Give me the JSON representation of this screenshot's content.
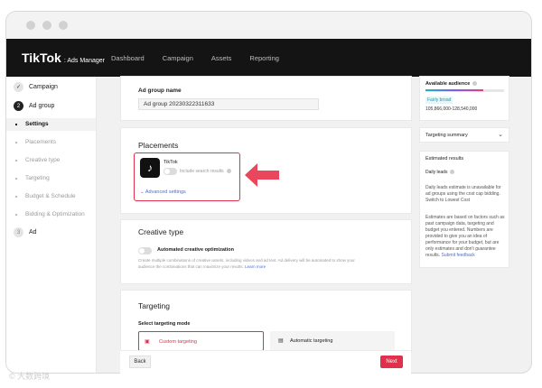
{
  "topnav": {
    "logo_main": "TikTok",
    "logo_sub": ": Ads Manager",
    "items": [
      "Dashboard",
      "Campaign",
      "Assets",
      "Reporting"
    ]
  },
  "sidebar": {
    "steps": [
      {
        "num": "✓",
        "label": "Campaign"
      },
      {
        "num": "2",
        "label": "Ad group"
      },
      {
        "num": "3",
        "label": "Ad"
      }
    ],
    "sub_items": [
      "Settings",
      "Placements",
      "Creative type",
      "Targeting",
      "Budget & Schedule",
      "Bidding & Optimization"
    ]
  },
  "ad_group": {
    "name_label": "Ad group name",
    "name_value": "Ad group 20230322311633"
  },
  "placements": {
    "title": "Placements",
    "tiktok_label": "TikTok",
    "include_search": "Include search results",
    "advanced": "Advanced settings"
  },
  "creative": {
    "title": "Creative type",
    "toggle_label": "Automated creative optimization",
    "desc_line1": "Create multiple combinations of creative assets, including videos and ad text. Ad delivery will be automated to show your",
    "desc_line2": "audience the combinations that can maximize your results.",
    "learn_more": "Learn more"
  },
  "targeting": {
    "title": "Targeting",
    "mode_label": "Select targeting mode",
    "custom": "Custom targeting",
    "automatic": "Automatic targeting"
  },
  "right": {
    "audience_title": "Available audience",
    "audience_status": "Fairly broad",
    "audience_range": "105,866,000-128,540,000",
    "targeting_summary": "Targeting summary",
    "estimated_title": "Estimated results",
    "daily_label": "Daily leads",
    "daily_line1": "Daily leads estimate is unavailable for",
    "daily_line2": "ad groups using the cost cap bidding.",
    "switch_link": "Switch to Lowest Cost",
    "est_lines": [
      "Estimates are based on factors such as",
      "past campaign data, targeting and",
      "budget you entered. Numbers are",
      "provided to give you an idea of",
      "performance for your budget, but are",
      "only estimates and don't guarantee"
    ],
    "est_last": "results.",
    "feedback": "Submit feedback"
  },
  "footer": {
    "back": "Back",
    "next": "Next"
  },
  "watermark": "© 大数跨境"
}
